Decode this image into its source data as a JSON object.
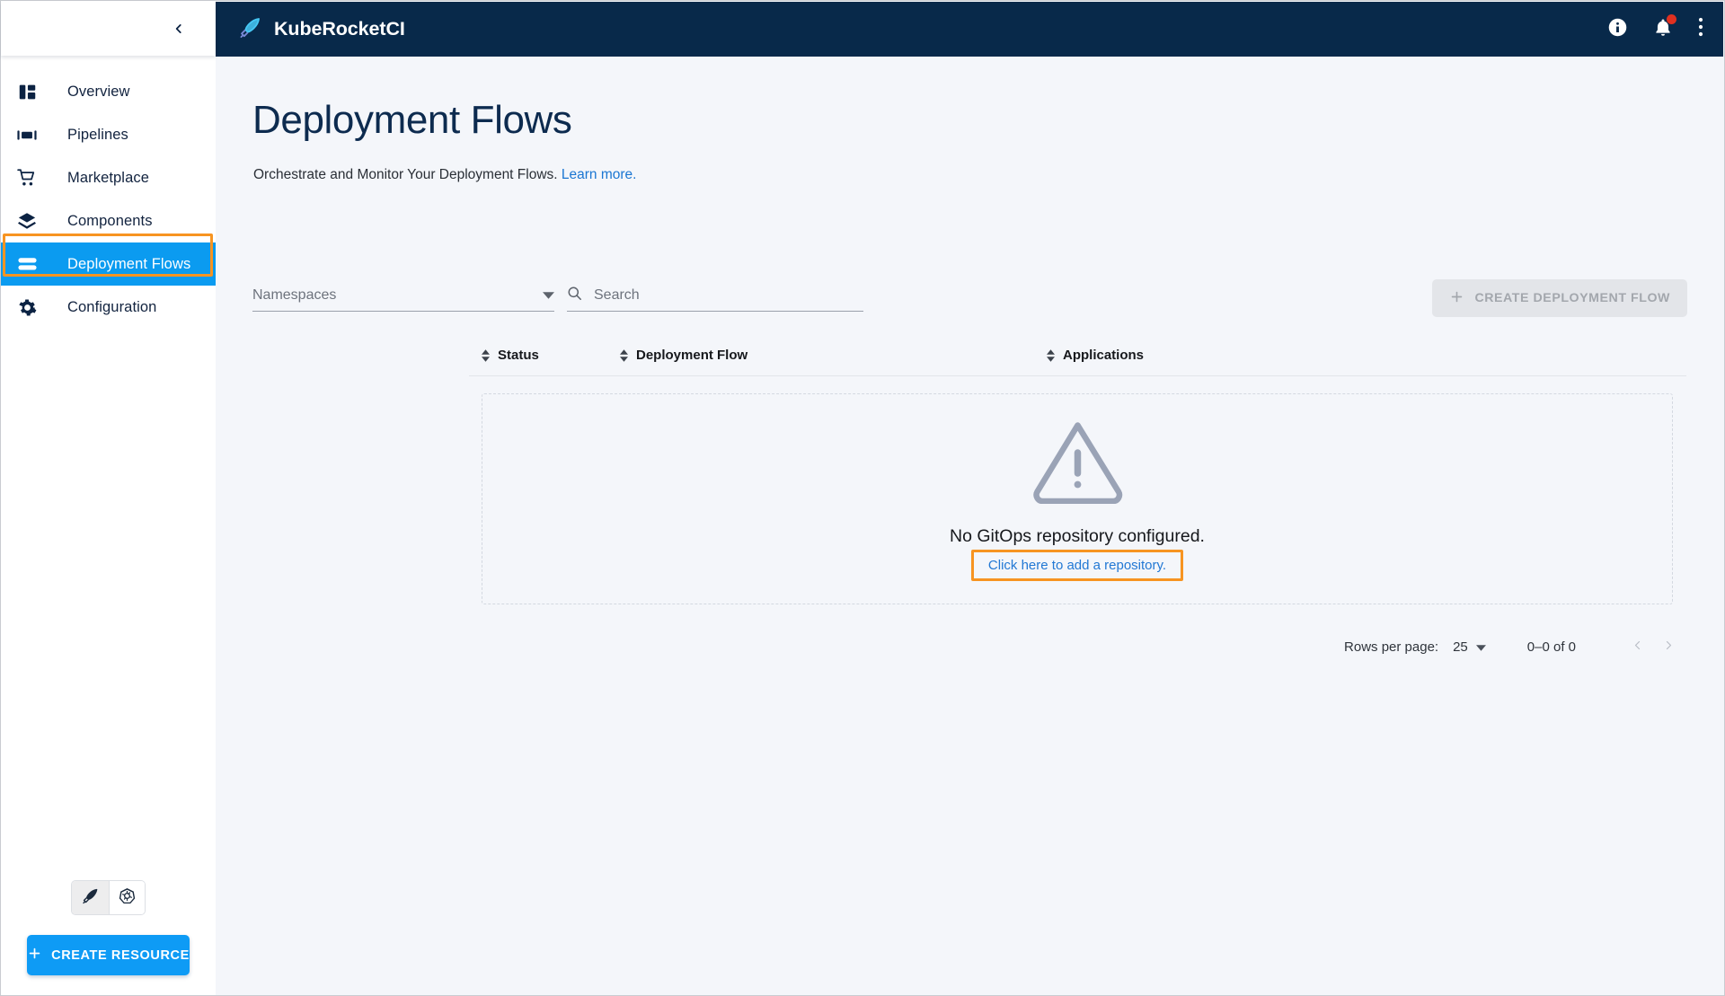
{
  "app": {
    "brand": "KubeRocketCI",
    "brand_logo_icon": "quill-rocket-icon",
    "accent_blue": "#0e9bf5",
    "header_bg": "#08294a",
    "highlight_orange": "#f79421"
  },
  "sidebar": {
    "collapse_icon": "chevron-left-icon",
    "items": [
      {
        "label": "Overview",
        "icon": "dashboard-icon",
        "active": false
      },
      {
        "label": "Pipelines",
        "icon": "pipelines-icon",
        "active": false
      },
      {
        "label": "Marketplace",
        "icon": "cart-icon",
        "active": false
      },
      {
        "label": "Components",
        "icon": "layers-icon",
        "active": false
      },
      {
        "label": "Deployment Flows",
        "icon": "deployment-flows-icon",
        "active": true
      },
      {
        "label": "Configuration",
        "icon": "gear-icon",
        "active": false
      }
    ],
    "mode_toggle": [
      {
        "icon": "quill-rocket-icon",
        "selected": true
      },
      {
        "icon": "kubernetes-icon",
        "selected": false
      }
    ],
    "create_resource_label": "CREATE RESOURCE",
    "create_resource_icon": "plus-icon"
  },
  "topbar": {
    "actions": [
      {
        "icon": "info-icon",
        "label": "Information"
      },
      {
        "icon": "bell-icon",
        "label": "Notifications",
        "badge": true
      },
      {
        "icon": "kebab-menu-icon",
        "label": "More options"
      }
    ]
  },
  "page": {
    "title": "Deployment Flows",
    "subtitle": "Orchestrate and Monitor Your Deployment Flows.",
    "subtitle_link": "Learn more."
  },
  "filters": {
    "namespaces": {
      "label": "Namespaces",
      "value": "",
      "chevron_icon": "chevron-down-icon"
    },
    "search": {
      "placeholder": "Search",
      "value": "",
      "icon": "search-icon"
    },
    "create_button": {
      "label": "CREATE DEPLOYMENT FLOW",
      "icon": "plus-icon",
      "disabled": true
    }
  },
  "table": {
    "columns": [
      {
        "label": "Status",
        "sortable": true
      },
      {
        "label": "Deployment Flow",
        "sortable": true
      },
      {
        "label": "Applications",
        "sortable": true
      }
    ],
    "rows": [],
    "empty_state": {
      "icon": "warning-triangle-icon",
      "title": "No GitOps repository configured.",
      "action_link": "Click here to add a repository."
    }
  },
  "pagination": {
    "rows_per_page_label": "Rows per page:",
    "rows_per_page_value": "25",
    "range_label": "0–0 of 0",
    "prev_icon": "chevron-left-icon",
    "next_icon": "chevron-right-icon"
  }
}
